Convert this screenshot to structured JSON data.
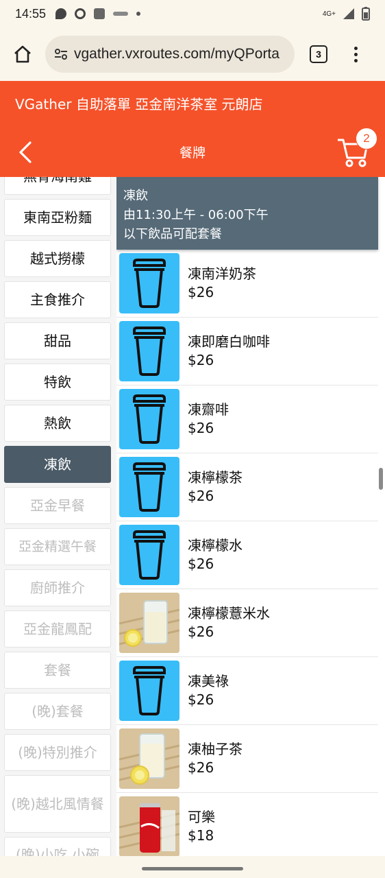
{
  "status_bar": {
    "time": "14:55",
    "network": "4G+"
  },
  "browser": {
    "url": "vgather.vxroutes.com/myQPorta",
    "tab_count": "3"
  },
  "header": {
    "store_title": "VGather 自助落單 亞金南洋茶室 元朗店",
    "page_title": "餐牌",
    "cart_count": "2",
    "accent_color": "#f5522a"
  },
  "sidebar": {
    "items": [
      {
        "label": "無骨海南雞"
      },
      {
        "label": "東南亞粉麵"
      },
      {
        "label": "越式撈檬"
      },
      {
        "label": "主食推介"
      },
      {
        "label": "甜品"
      },
      {
        "label": "特飲"
      },
      {
        "label": "熱飲"
      },
      {
        "label": "凍飲"
      },
      {
        "label": "亞金早餐"
      },
      {
        "label": "亞金精選午餐"
      },
      {
        "label": "廚師推介"
      },
      {
        "label": "亞金龍鳳配"
      },
      {
        "label": "套餐"
      },
      {
        "label": "(晚)套餐"
      },
      {
        "label": "(晚)特別推介"
      },
      {
        "label": "(晚)越北風情餐"
      },
      {
        "label": "(晚)小吃 小碗"
      }
    ],
    "active_label": "凍飲"
  },
  "section": {
    "title": "凍飲",
    "hours": "由11:30上午 - 06:00下午",
    "note": "以下飲品可配套餐"
  },
  "menu_items": [
    {
      "name": "凍南洋奶茶",
      "price": "$26",
      "icon": "cup-icon"
    },
    {
      "name": "凍即磨白咖啡",
      "price": "$26",
      "icon": "cup-icon"
    },
    {
      "name": "凍齋啡",
      "price": "$26",
      "icon": "cup-icon"
    },
    {
      "name": "凍檸檬茶",
      "price": "$26",
      "icon": "cup-icon"
    },
    {
      "name": "凍檸檬水",
      "price": "$26",
      "icon": "cup-icon"
    },
    {
      "name": "凍檸檬薏米水",
      "price": "$26",
      "icon": "lemon-drink-photo"
    },
    {
      "name": "凍美祿",
      "price": "$26",
      "icon": "cup-icon"
    },
    {
      "name": "凍柚子茶",
      "price": "$26",
      "icon": "lemon-drink-photo"
    },
    {
      "name": "可樂",
      "price": "$18",
      "icon": "cola-can-photo"
    }
  ]
}
